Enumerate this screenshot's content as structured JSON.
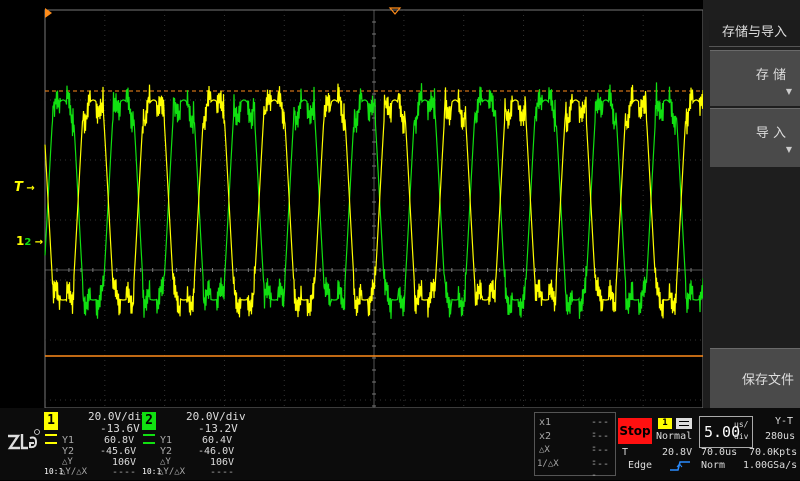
{
  "menu": {
    "title": "存储与导入",
    "store_label": "存 储",
    "import_label": "导 入",
    "save_file_label": "保存文件"
  },
  "markers": {
    "trigger_label": "T",
    "ch_marker_label": "1",
    "ch_marker_label2": "2"
  },
  "ch1": {
    "number": "1",
    "scale": "20.0V/div",
    "offset": "-13.6V",
    "y1_label": "Y1",
    "y1": "60.8V",
    "y2_label": "Y2",
    "y2": "-45.6V",
    "dy_label": "△Y",
    "dy": "106V",
    "probe": "10:1",
    "dydx_label": "△Y/△X",
    "dydx": "----",
    "color": "#ffff00"
  },
  "ch2": {
    "number": "2",
    "scale": "20.0V/div",
    "offset": "-13.2V",
    "y1_label": "Y1",
    "y1": "60.4V",
    "y2_label": "Y2",
    "y2": "-46.0V",
    "dy_label": "△Y",
    "dy": "106V",
    "probe": "10:1",
    "dydx_label": "△Y/△X",
    "dydx": "----",
    "color": "#11e011"
  },
  "cursor": {
    "x1_label": "x1",
    "x1": "----",
    "x2_label": "x2",
    "x2": "----",
    "dx_label": "△X",
    "dx": "----",
    "inv_dx_label": "1/△X",
    "inv_dx": "----"
  },
  "trigger": {
    "run_state": "Stop",
    "source": "1",
    "mode": "Normal",
    "level_label": "T",
    "level": "20.8V",
    "type": "Edge"
  },
  "timebase": {
    "scale_value": "5.00",
    "scale_unit_top": "us/",
    "scale_unit_bottom": "div",
    "mode": "Y-T",
    "window": "280us",
    "delay": "70.0us",
    "memory": "70.0Kpts",
    "acq_mode": "Norm",
    "sample_rate": "1.00GSa/s"
  },
  "colors": {
    "ch1": "#ffff00",
    "ch2": "#11e011",
    "cursor_line": "#ff8c1a",
    "stop": "#ff1010"
  }
}
